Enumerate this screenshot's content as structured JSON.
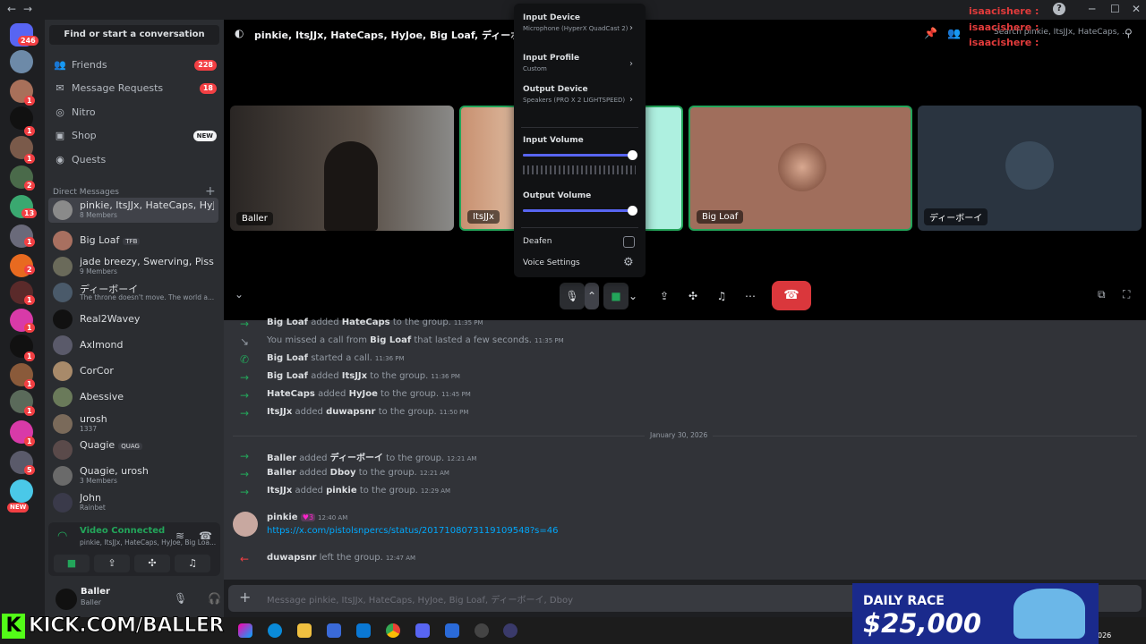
{
  "titlebar": {
    "back": "←",
    "forward": "→",
    "min": "─",
    "max": "☐",
    "close": "✕",
    "help": "?"
  },
  "rail": {
    "home_badge": "246",
    "badges": [
      "1",
      "1",
      "1",
      "1",
      "1",
      "2",
      "13",
      "1",
      "2",
      "1",
      "1",
      "1",
      "1",
      "1",
      "1",
      "1",
      "1",
      "5",
      "1"
    ],
    "new_badge": "NEW"
  },
  "sidebar": {
    "search_button": "Find or start a conversation",
    "nav": [
      {
        "label": "Friends",
        "count": "228",
        "icon": "friends-icon"
      },
      {
        "label": "Message Requests",
        "count": "18",
        "icon": "mail-icon"
      },
      {
        "label": "Nitro",
        "icon": "nitro-icon"
      },
      {
        "label": "Shop",
        "tag": "NEW",
        "icon": "shop-icon"
      },
      {
        "label": "Quests",
        "icon": "quests-icon"
      }
    ],
    "dm_header": "Direct Messages",
    "dm_add": "+",
    "dms": [
      {
        "name": "pinkie, ItsJJx, HateCaps, HyJo...",
        "sub": "8 Members"
      },
      {
        "name": "Big Loaf",
        "tag": "TFB"
      },
      {
        "name": "jade breezy, Swerving, Pissy pa...",
        "sub": "9 Members"
      },
      {
        "name": "ディーボーイ",
        "sub": "The throne doesn't move. The world a..."
      },
      {
        "name": "Real2Wavey"
      },
      {
        "name": "Axlmond"
      },
      {
        "name": "CorCor"
      },
      {
        "name": "Abessive"
      },
      {
        "name": "urosh",
        "sub": "1337"
      },
      {
        "name": "Quagie",
        "tag": "QUAG"
      },
      {
        "name": "Quagie, urosh",
        "sub": "3 Members"
      },
      {
        "name": "John",
        "sub": "Rainbet"
      }
    ],
    "voice": {
      "title": "Video Connected",
      "sub": "pinkie, ItsJJx, HateCaps, HyJoe, Big Loa..."
    },
    "user": {
      "name": "Baller",
      "status": "Baller"
    }
  },
  "call": {
    "title": "pinkie, ItsJJx, HateCaps, HyJoe, Big Loaf, ディーボーイ, Dboy",
    "search_placeholder": "Search pinkie, ItsJJx, HateCaps, ...",
    "tiles": [
      "Baller",
      "ItsJJx",
      "Big Loaf",
      "ディーボーイ"
    ]
  },
  "popout": {
    "input_device": {
      "label": "Input Device",
      "value": "Microphone (HyperX QuadCast 2)"
    },
    "input_profile": {
      "label": "Input Profile",
      "value": "Custom"
    },
    "output_device": {
      "label": "Output Device",
      "value": "Speakers (PRO X 2 LIGHTSPEED)"
    },
    "input_volume": {
      "label": "Input Volume",
      "level": 0.97
    },
    "output_volume": {
      "label": "Output Volume",
      "level": 0.97
    },
    "deafen": "Deafen",
    "voice_settings": "Voice Settings"
  },
  "chat": {
    "messages": [
      {
        "a": "Big Loaf",
        "v": "added",
        "b": "HateCaps",
        "e": "to the group.",
        "t": "11:35 PM"
      },
      {
        "a": "You missed a call from",
        "b": "Big Loaf",
        "e": "that lasted a few seconds.",
        "t": "11:35 PM"
      },
      {
        "a": "Big Loaf",
        "v": "started a call.",
        "t": "11:36 PM"
      },
      {
        "a": "Big Loaf",
        "v": "added",
        "b": "ItsJJx",
        "e": "to the group.",
        "t": "11:36 PM"
      },
      {
        "a": "HateCaps",
        "v": "added",
        "b": "HyJoe",
        "e": "to the group.",
        "t": "11:45 PM"
      },
      {
        "a": "ItsJJx",
        "v": "added",
        "b": "duwapsnr",
        "e": "to the group.",
        "t": "11:50 PM"
      }
    ],
    "date_divider": "January 30, 2026",
    "messages2": [
      {
        "a": "Baller",
        "v": "added",
        "b": "ディーボーイ",
        "e": "to the group.",
        "t": "12:21 AM"
      },
      {
        "a": "Baller",
        "v": "added",
        "b": "Dboy",
        "e": "to the group.",
        "t": "12:21 AM"
      },
      {
        "a": "ItsJJx",
        "v": "added",
        "b": "pinkie",
        "e": "to the group.",
        "t": "12:29 AM"
      }
    ],
    "post": {
      "author": "pinkie",
      "tag": "♥3",
      "time": "12:40 AM",
      "link": "https://x.com/pistolsnpercs/status/2017108073119109548?s=46"
    },
    "leave": {
      "a": "duwapsnr",
      "v": "left the group.",
      "t": "12:47 AM"
    },
    "input_placeholder": "Message pinkie, ItsJJx, HateCaps, HyJoe, Big Loaf, ディーボーイ, Dboy"
  },
  "overlay": {
    "kick": "KICK.COM/BALLER",
    "race_line1": "DAILY RACE",
    "race_line2": "$25,000",
    "chat_name": "isaacishere :",
    "time_small": "026"
  }
}
